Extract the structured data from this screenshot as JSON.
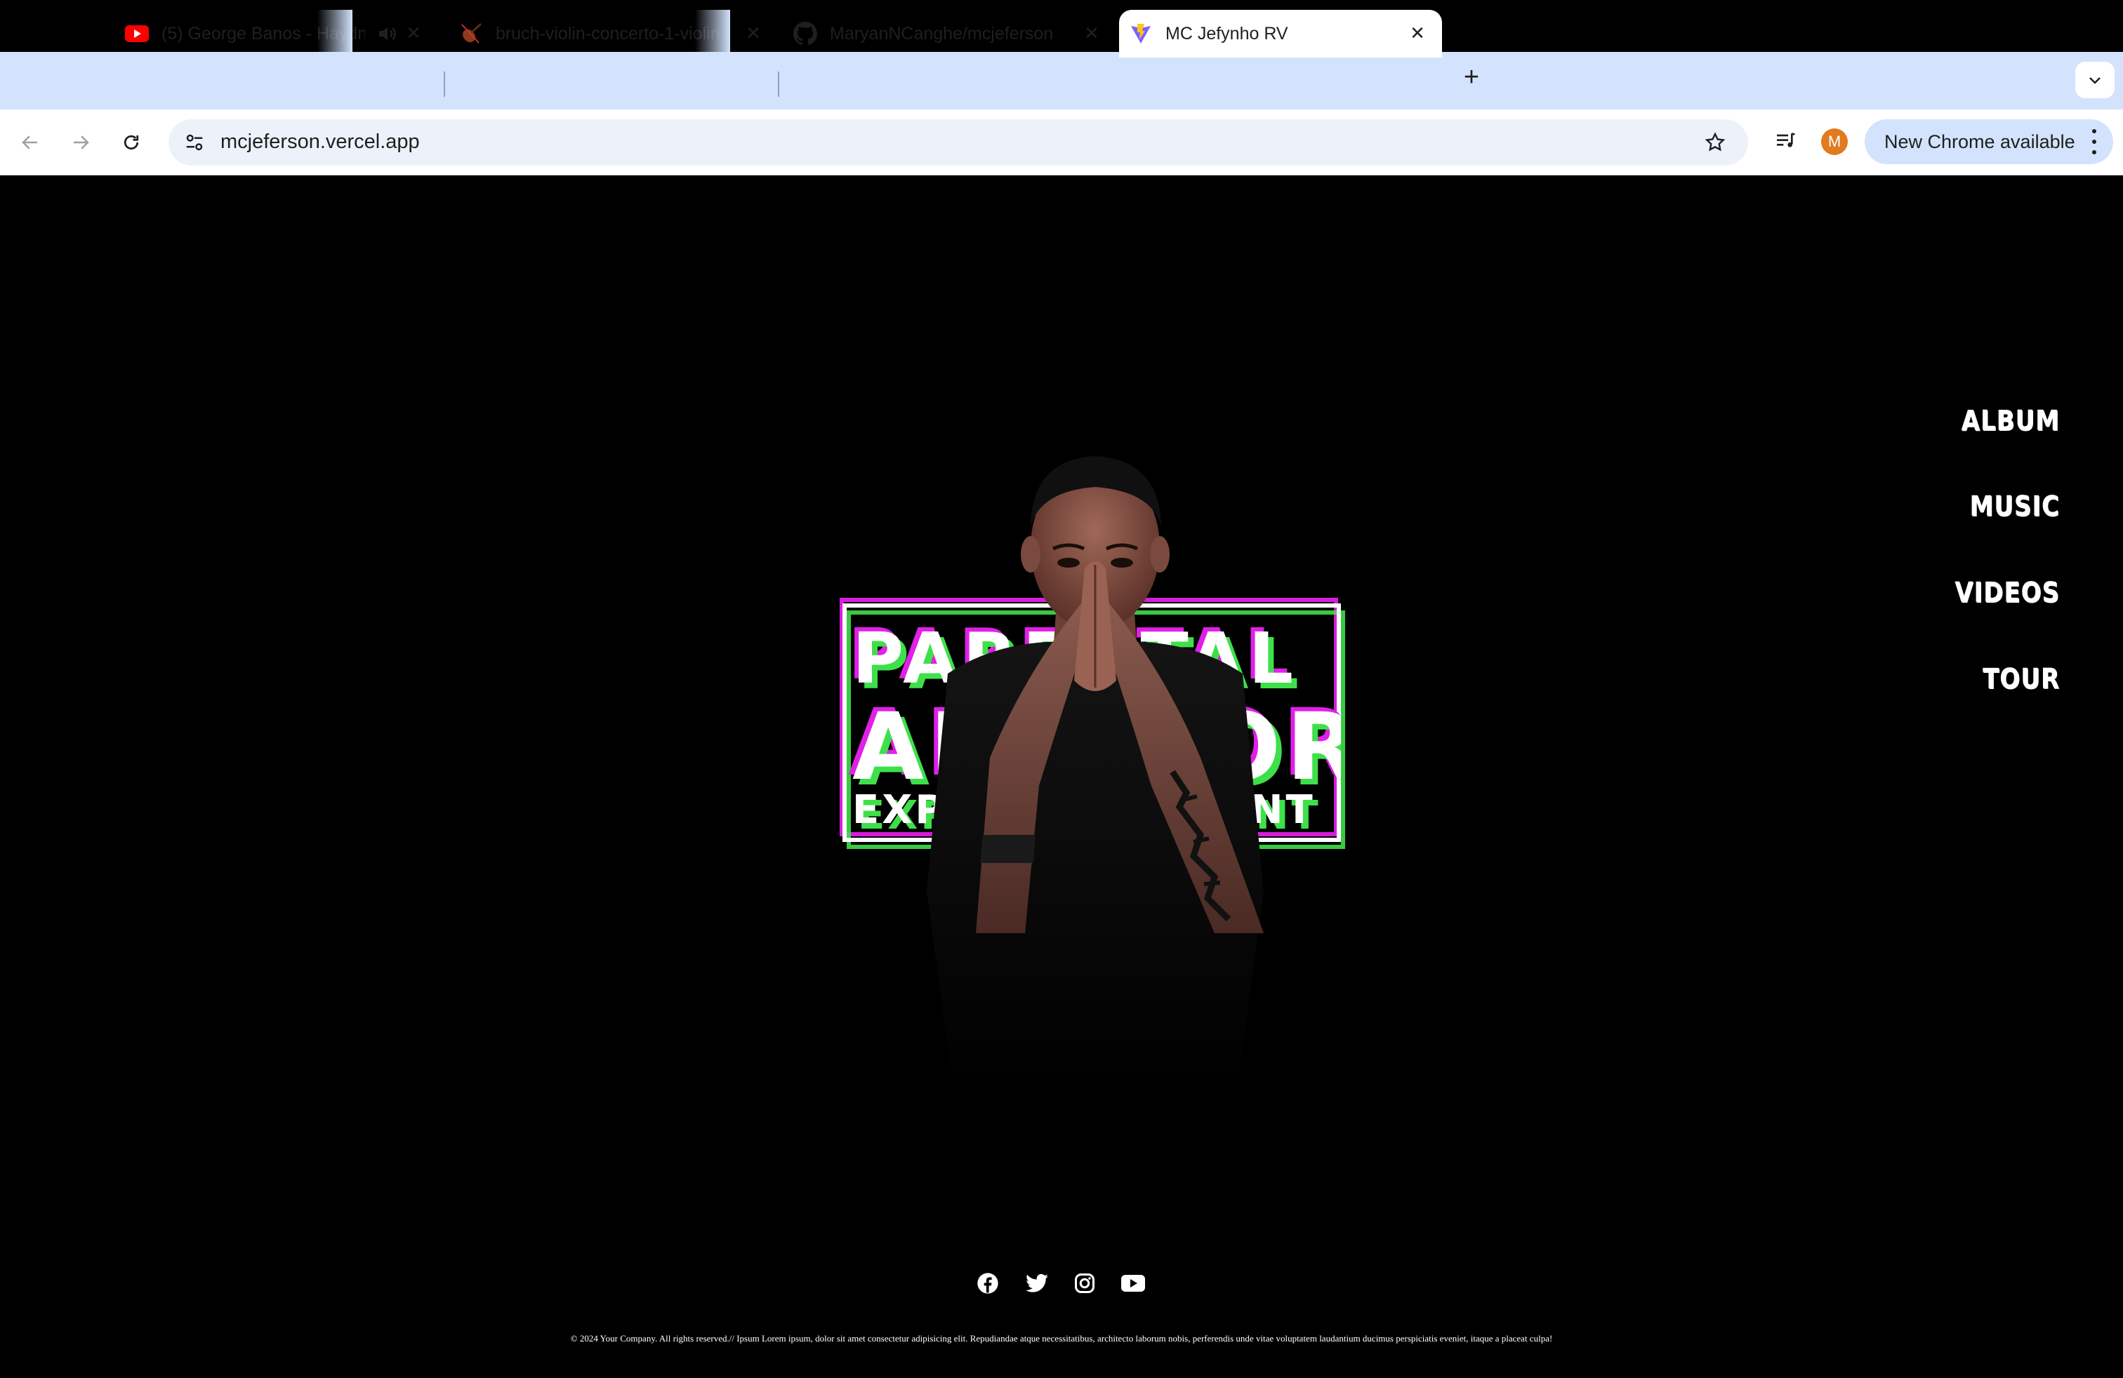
{
  "browser": {
    "tabs": [
      {
        "title": "(5) George Banos - Haydn",
        "favicon": "youtube-icon",
        "audio": true,
        "active": false
      },
      {
        "title": "bruch-violin-concerto-1-violin",
        "favicon": "violin-icon",
        "active": false
      },
      {
        "title": "MaryanNCanghe/mcjeferson",
        "favicon": "github-icon",
        "active": false
      },
      {
        "title": "MC Jefynho RV",
        "favicon": "vite-icon",
        "active": true
      }
    ],
    "url": "mcjeferson.vercel.app",
    "profile_initial": "M",
    "update_label": "New Chrome available",
    "colors": {
      "tabstrip": "#d3e3fd",
      "omnibox": "#edf2fa",
      "avatar": "#e07b1e"
    }
  },
  "site": {
    "nav": [
      "ALBUM",
      "MUSIC",
      "VIDEOS",
      "TOUR"
    ],
    "advisory": {
      "line1": "PARENTAL",
      "line2": "ADVISORY",
      "line3": "EXPLICIT CONTENT"
    },
    "social": [
      "facebook-icon",
      "twitter-icon",
      "instagram-icon",
      "youtube-icon"
    ],
    "footer": "© 2024 Your Company. All rights reserved.// Ipsum Lorem ipsum, dolor sit amet consectetur adipisicing elit. Repudiandae atque necessitatibus, architecto laborum nobis, perferendis unde vitae voluptatem laudantium ducimus perspiciatis eveniet, itaque a placeat culpa!",
    "colors": {
      "magenta": "#e020e8",
      "green": "#3ee04a",
      "background": "#000000"
    }
  }
}
